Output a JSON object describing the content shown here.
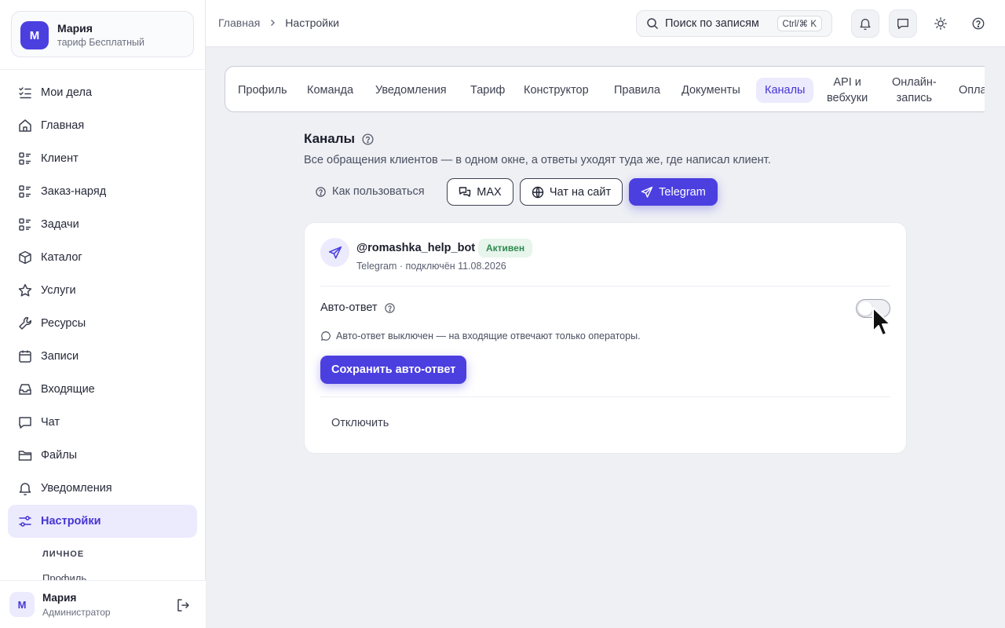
{
  "org": {
    "avatar_letter": "М",
    "name": "Мария",
    "plan": "тариф Бесплатный"
  },
  "sidebar": {
    "items": [
      {
        "label": "Мои дела",
        "icon": "checklist-icon"
      },
      {
        "label": "Главная",
        "icon": "home-icon"
      },
      {
        "label": "Клиент",
        "icon": "list-icon"
      },
      {
        "label": "Заказ-наряд",
        "icon": "list-icon"
      },
      {
        "label": "Задачи",
        "icon": "list-icon"
      },
      {
        "label": "Каталог",
        "icon": "box-icon"
      },
      {
        "label": "Услуги",
        "icon": "star-icon"
      },
      {
        "label": "Ресурсы",
        "icon": "wrench-icon"
      },
      {
        "label": "Записи",
        "icon": "calendar-icon"
      },
      {
        "label": "Входящие",
        "icon": "inbox-icon"
      },
      {
        "label": "Чат",
        "icon": "chat-icon"
      },
      {
        "label": "Файлы",
        "icon": "folder-icon"
      },
      {
        "label": "Уведомления",
        "icon": "bell-icon"
      },
      {
        "label": "Настройки",
        "icon": "sliders-icon",
        "active": true
      }
    ],
    "section_label": "ЛИЧНОЕ",
    "sub_item": "Профиль"
  },
  "user": {
    "avatar_letter": "М",
    "name": "Мария",
    "role": "Администратор"
  },
  "breadcrumb": {
    "home": "Главная",
    "current": "Настройки"
  },
  "search": {
    "placeholder": "Поиск по записям",
    "shortcut": "Ctrl/⌘ K"
  },
  "tabs": [
    {
      "label": "Профиль"
    },
    {
      "label": "Команда"
    },
    {
      "label": "Уведомления"
    },
    {
      "label": "Тариф"
    },
    {
      "label": "Конструктор"
    },
    {
      "label": "Правила"
    },
    {
      "label": "Документы"
    },
    {
      "label": "Каналы",
      "active": true
    },
    {
      "label": "API и\nвебхуки"
    },
    {
      "label": "Онлайн-\nзапись"
    },
    {
      "label": "Опла"
    }
  ],
  "page": {
    "title": "Каналы",
    "subtitle": "Все обращения клиентов — в одном окне, а ответы уходят туда же, где написал клиент.",
    "howto": "Как пользоваться",
    "channels": [
      {
        "label": "MAX",
        "icon": "chat-bubbles-icon"
      },
      {
        "label": "Чат на сайт",
        "icon": "globe-icon"
      },
      {
        "label": "Telegram",
        "icon": "send-icon",
        "active": true
      }
    ]
  },
  "bot": {
    "name": "@romashka_help_bot",
    "status": "Активен",
    "meta": "Telegram · подключён 11.08.2026",
    "auto_reply_label": "Авто-ответ",
    "auto_reply_enabled": false,
    "auto_reply_note": "Авто-ответ выключен — на входящие отвечают только операторы.",
    "save_label": "Сохранить авто-ответ",
    "disconnect_label": "Отключить"
  },
  "colors": {
    "accent": "#4b3fe0",
    "accent_soft": "#eceafd",
    "success": "#2f8a4e",
    "success_soft": "#e7f5ec"
  }
}
